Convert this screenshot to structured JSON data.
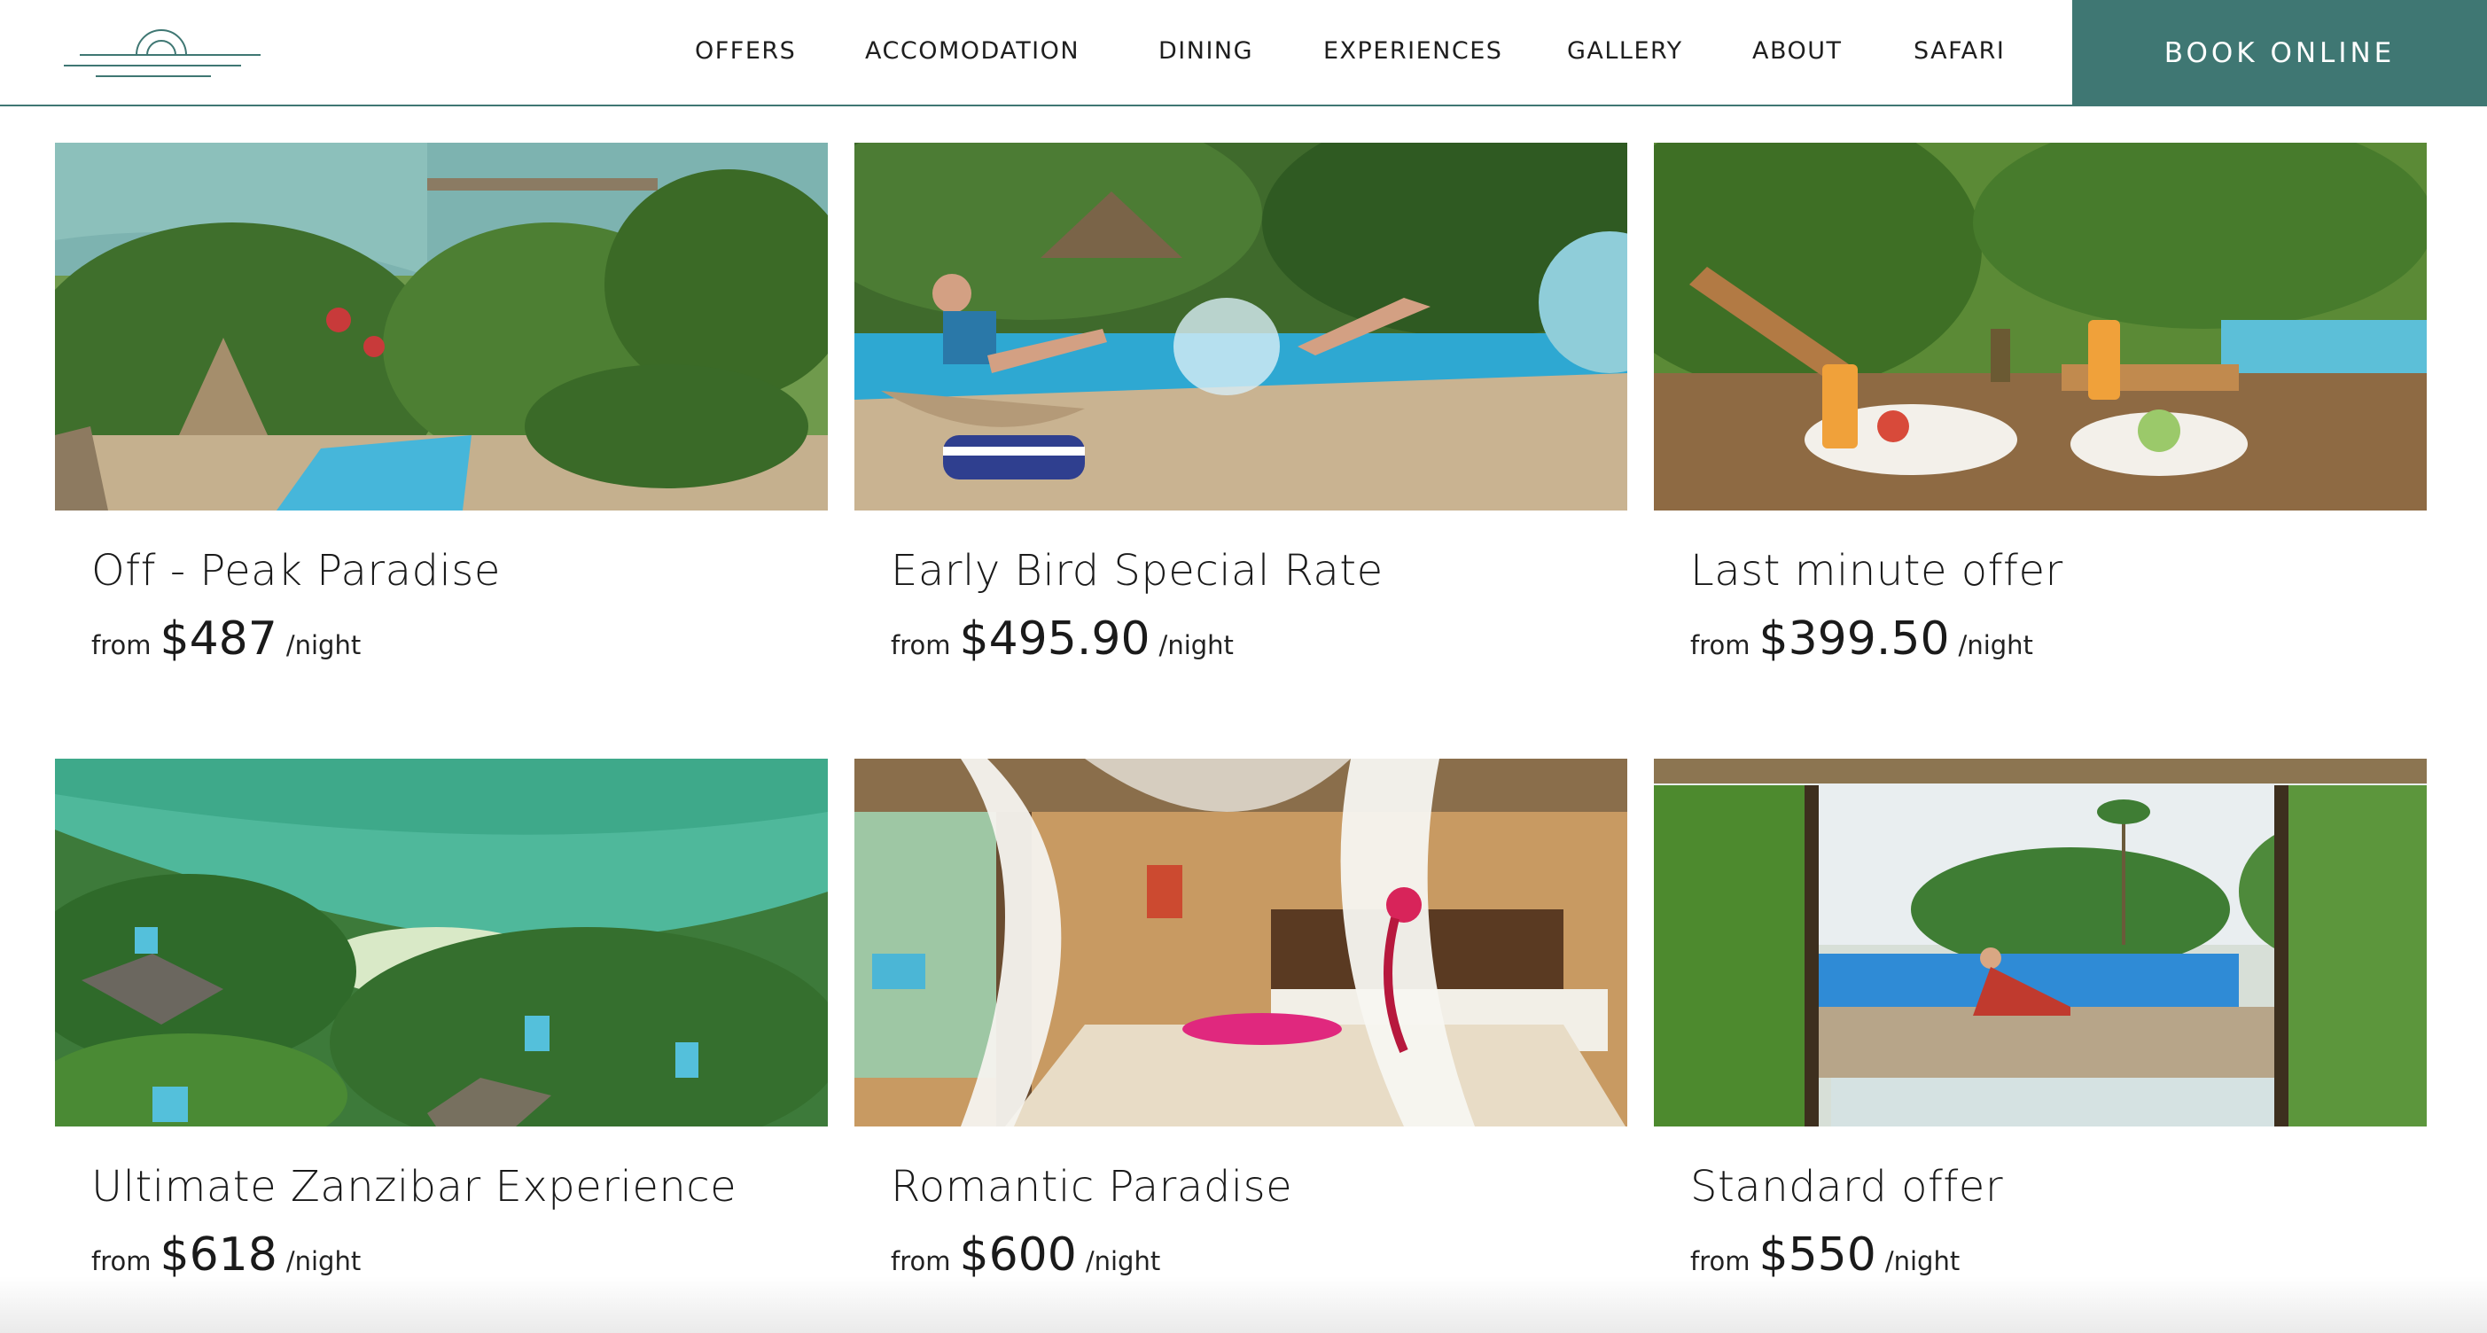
{
  "header": {
    "nav": [
      "OFFERS",
      "ACCOMODATION",
      "DINING",
      "EXPERIENCES",
      "GALLERY",
      "ABOUT",
      "SAFARI"
    ],
    "book_label": "BOOK ONLINE"
  },
  "colors": {
    "brand": "#3f7773",
    "text": "#1a1a1a",
    "background": "#ffffff"
  },
  "offers": [
    {
      "title": "Off - Peak Paradise",
      "from": "from",
      "price": "$487",
      "unit": "/night",
      "image": "aerial villa with thatched cabana and pool by the sea"
    },
    {
      "title": "Early Bird Special Rate",
      "from": "from",
      "price": "$495.90",
      "unit": "/night",
      "image": "guests splashing in resort pool"
    },
    {
      "title": "Last minute offer",
      "from": "from",
      "price": "$399.50",
      "unit": "/night",
      "image": "breakfast with juices on terrace by pool"
    },
    {
      "title": "Ultimate Zanzibar Experience",
      "from": "from",
      "price": "$618",
      "unit": "/night",
      "image": "aerial view of turquoise sea and villas among palms"
    },
    {
      "title": "Romantic Paradise",
      "from": "from",
      "price": "$600",
      "unit": "/night",
      "image": "canopy bed with white drapes and flower petals"
    },
    {
      "title": "Standard offer",
      "from": "from",
      "price": "$550",
      "unit": "/night",
      "image": "view from villa onto pool with guest sunbathing"
    }
  ]
}
